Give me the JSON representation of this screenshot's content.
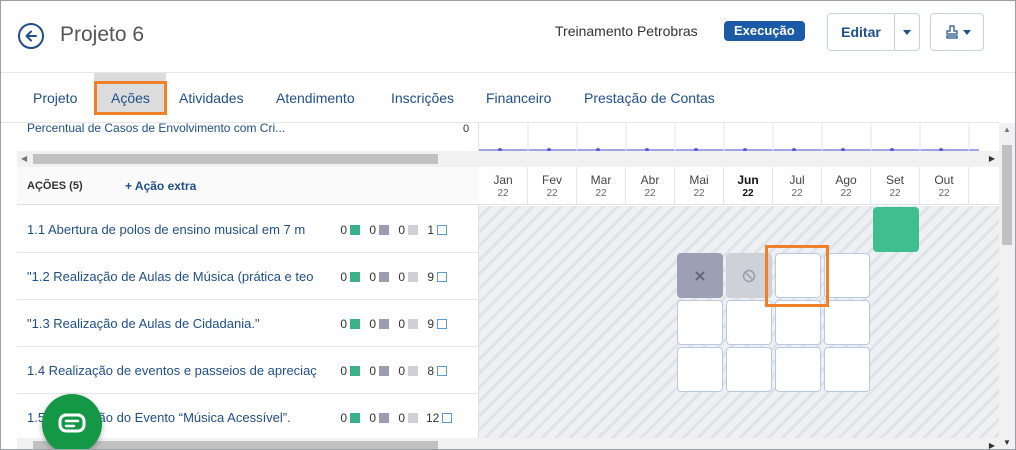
{
  "header": {
    "title": "Projeto 6",
    "org": "Treinamento Petrobras",
    "status": "Execução",
    "edit_label": "Editar"
  },
  "tabs": [
    {
      "label": "Projeto"
    },
    {
      "label": "Ações"
    },
    {
      "label": "Atividades"
    },
    {
      "label": "Atendimento"
    },
    {
      "label": "Inscrições"
    },
    {
      "label": "Financeiro"
    },
    {
      "label": "Prestação de Contas"
    }
  ],
  "indicator": {
    "label": "Percentual de Casos de Envolvimento com Cri...",
    "value": "0"
  },
  "actions": {
    "title": "AÇÕES (5)",
    "extra_label": "+ Ação extra",
    "rows": [
      {
        "label": "1.1 Abertura de polos de ensino musical em 7 m",
        "c1": "0",
        "c2": "0",
        "c3": "0",
        "c4": "1"
      },
      {
        "label": "\"1.2 Realização de Aulas de Música (prática e teo",
        "c1": "0",
        "c2": "0",
        "c3": "0",
        "c4": "9"
      },
      {
        "label": "\"1.3 Realização de Aulas de Cidadania.\"",
        "c1": "0",
        "c2": "0",
        "c3": "0",
        "c4": "9"
      },
      {
        "label": "1.4 Realização de eventos e passeios de apreciaç",
        "c1": "0",
        "c2": "0",
        "c3": "0",
        "c4": "8"
      },
      {
        "label": "1.5 Realização do Evento “Música Acessível”.",
        "c1": "0",
        "c2": "0",
        "c3": "0",
        "c4": "12"
      }
    ]
  },
  "months": [
    {
      "m": "Jan",
      "y": "22"
    },
    {
      "m": "Fev",
      "y": "22"
    },
    {
      "m": "Mar",
      "y": "22"
    },
    {
      "m": "Abr",
      "y": "22"
    },
    {
      "m": "Mai",
      "y": "22"
    },
    {
      "m": "Jun",
      "y": "22"
    },
    {
      "m": "Jul",
      "y": "22"
    },
    {
      "m": "Ago",
      "y": "22"
    },
    {
      "m": "Set",
      "y": "22"
    },
    {
      "m": "Out",
      "y": "22"
    }
  ],
  "colors": {
    "accent": "#1f4f8a",
    "status_badge": "#1b5aa6",
    "done": "#3fbf8f",
    "cancelled": "#9da0b5",
    "blocked": "#cfd1d8",
    "highlight": "#f07f2a",
    "chat": "#149845"
  },
  "icons": {
    "back": "arrow-left-icon",
    "caret": "chevron-down-icon",
    "export": "stamp-icon",
    "cancel": "x-icon",
    "blocked": "ban-icon",
    "chat": "chat-icon"
  }
}
